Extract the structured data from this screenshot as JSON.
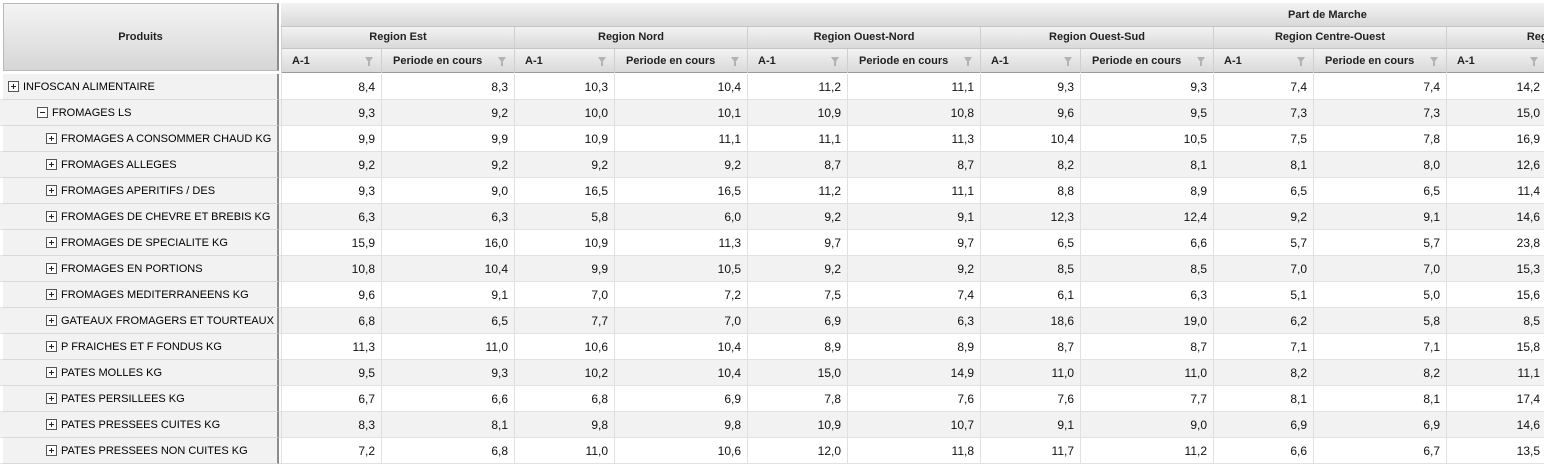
{
  "header": {
    "row_header_label": "Produits",
    "group_title": "Part de Marche",
    "regions": [
      "Region Est",
      "Region Nord",
      "Region Ouest-Nord",
      "Region Ouest-Sud",
      "Region Centre-Ouest",
      "Region"
    ],
    "col_a1": "A-1",
    "col_periode": "Periode en cours"
  },
  "rows": [
    {
      "label": "INFOSCAN ALIMENTAIRE",
      "expander": "plus",
      "values": [
        "8,4",
        "8,3",
        "10,3",
        "10,4",
        "11,2",
        "11,1",
        "9,3",
        "9,3",
        "7,4",
        "7,4",
        "14,2"
      ]
    },
    {
      "label": "FROMAGES LS",
      "expander": "minus",
      "values": [
        "9,3",
        "9,2",
        "10,0",
        "10,1",
        "10,9",
        "10,8",
        "9,6",
        "9,5",
        "7,3",
        "7,3",
        "15,0"
      ]
    },
    {
      "label": "FROMAGES A CONSOMMER CHAUD KG",
      "expander": "plus",
      "values": [
        "9,9",
        "9,9",
        "10,9",
        "11,1",
        "11,1",
        "11,3",
        "10,4",
        "10,5",
        "7,5",
        "7,8",
        "16,9"
      ]
    },
    {
      "label": "FROMAGES ALLEGES",
      "expander": "plus",
      "values": [
        "9,2",
        "9,2",
        "9,2",
        "9,2",
        "8,7",
        "8,7",
        "8,2",
        "8,1",
        "8,1",
        "8,0",
        "12,6"
      ]
    },
    {
      "label": "FROMAGES APERITIFS / DES",
      "expander": "plus",
      "values": [
        "9,3",
        "9,0",
        "16,5",
        "16,5",
        "11,2",
        "11,1",
        "8,8",
        "8,9",
        "6,5",
        "6,5",
        "11,4"
      ]
    },
    {
      "label": "FROMAGES DE CHEVRE ET BREBIS KG",
      "expander": "plus",
      "values": [
        "6,3",
        "6,3",
        "5,8",
        "6,0",
        "9,2",
        "9,1",
        "12,3",
        "12,4",
        "9,2",
        "9,1",
        "14,6"
      ]
    },
    {
      "label": "FROMAGES DE SPECIALITE KG",
      "expander": "plus",
      "values": [
        "15,9",
        "16,0",
        "10,9",
        "11,3",
        "9,7",
        "9,7",
        "6,5",
        "6,6",
        "5,7",
        "5,7",
        "23,8"
      ]
    },
    {
      "label": "FROMAGES EN PORTIONS",
      "expander": "plus",
      "values": [
        "10,8",
        "10,4",
        "9,9",
        "10,5",
        "9,2",
        "9,2",
        "8,5",
        "8,5",
        "7,0",
        "7,0",
        "15,3"
      ]
    },
    {
      "label": "FROMAGES MEDITERRANEENS KG",
      "expander": "plus",
      "values": [
        "9,6",
        "9,1",
        "7,0",
        "7,2",
        "7,5",
        "7,4",
        "6,1",
        "6,3",
        "5,1",
        "5,0",
        "15,6"
      ]
    },
    {
      "label": "GATEAUX FROMAGERS ET TOURTEAUX",
      "expander": "plus",
      "values": [
        "6,8",
        "6,5",
        "7,7",
        "7,0",
        "6,9",
        "6,3",
        "18,6",
        "19,0",
        "6,2",
        "5,8",
        "8,5"
      ]
    },
    {
      "label": "P FRAICHES ET F FONDUS KG",
      "expander": "plus",
      "values": [
        "11,3",
        "11,0",
        "10,6",
        "10,4",
        "8,9",
        "8,9",
        "8,7",
        "8,7",
        "7,1",
        "7,1",
        "15,8"
      ]
    },
    {
      "label": "PATES MOLLES KG",
      "expander": "plus",
      "values": [
        "9,5",
        "9,3",
        "10,2",
        "10,4",
        "15,0",
        "14,9",
        "11,0",
        "11,0",
        "8,2",
        "8,2",
        "11,1"
      ]
    },
    {
      "label": "PATES PERSILLEES KG",
      "expander": "plus",
      "values": [
        "6,7",
        "6,6",
        "6,8",
        "6,9",
        "7,8",
        "7,6",
        "7,6",
        "7,7",
        "8,1",
        "8,1",
        "17,4"
      ]
    },
    {
      "label": "PATES PRESSEES CUITES KG",
      "expander": "plus",
      "values": [
        "8,3",
        "8,1",
        "9,8",
        "9,8",
        "10,9",
        "10,7",
        "9,1",
        "9,0",
        "6,9",
        "6,9",
        "14,6"
      ]
    },
    {
      "label": "PATES PRESSEES NON CUITES KG",
      "expander": "plus",
      "values": [
        "7,2",
        "6,8",
        "11,0",
        "10,6",
        "12,0",
        "11,8",
        "11,7",
        "11,2",
        "6,6",
        "6,7",
        "13,5"
      ]
    }
  ]
}
